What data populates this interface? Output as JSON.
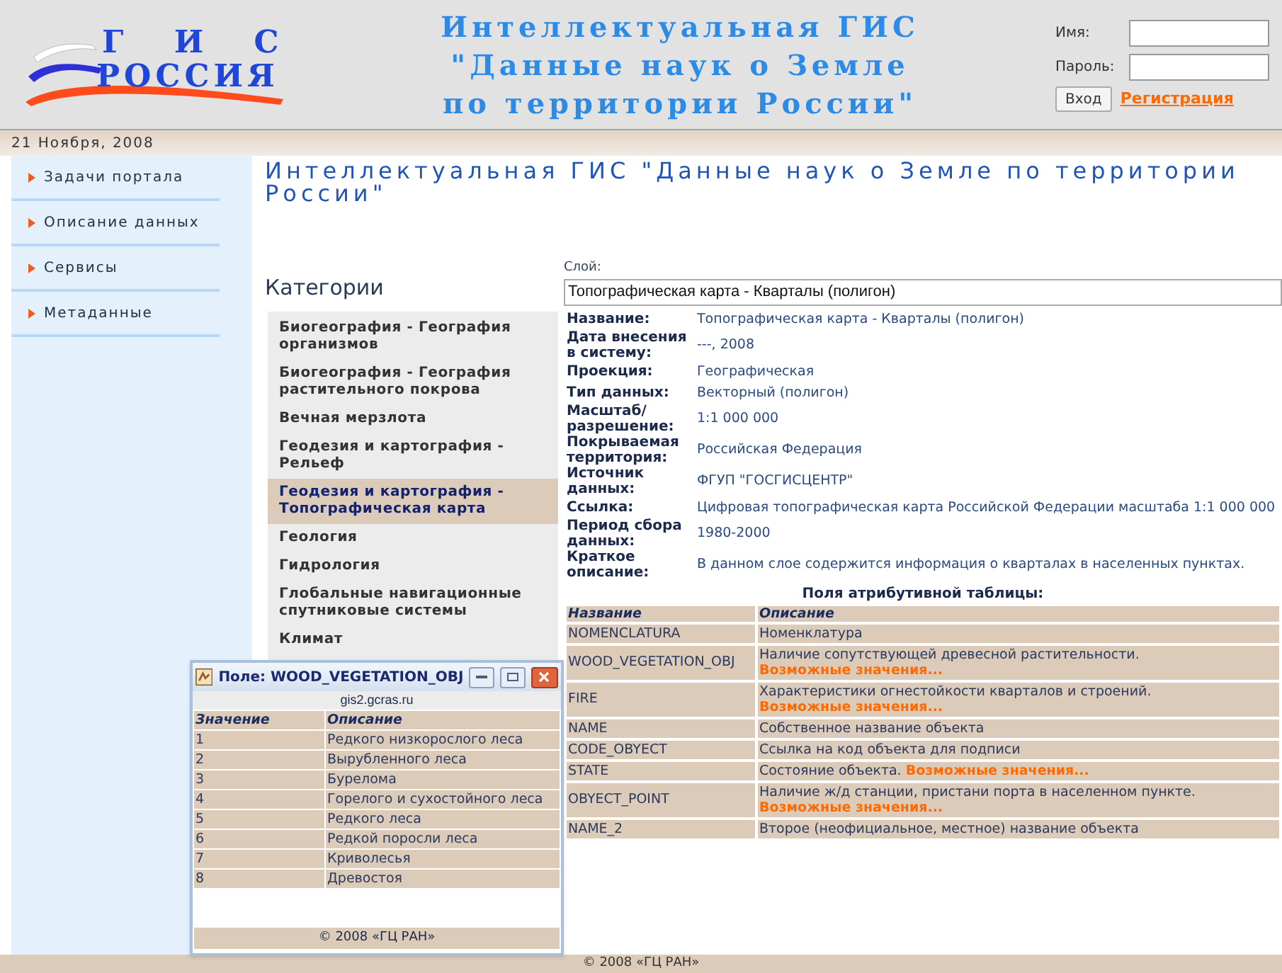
{
  "header": {
    "logo": {
      "line1": "Г И С",
      "line2": "РОССИЯ"
    },
    "title_lines": [
      "Интеллектуальная ГИС",
      "\"Данные наук о Земле",
      "по территории России\""
    ],
    "login": {
      "name_label": "Имя:",
      "password_label": "Пароль:",
      "button": "Вход",
      "register_link": "Регистрация"
    }
  },
  "date": "21 Ноября, 2008",
  "sidebar": {
    "items": [
      {
        "label": "Задачи портала"
      },
      {
        "label": "Описание данных"
      },
      {
        "label": "Сервисы"
      },
      {
        "label": "Метаданные"
      }
    ]
  },
  "page_heading": "Интеллектуальная ГИС \"Данные наук о Земле по территории России\"",
  "categories": {
    "title": "Категории",
    "items": [
      {
        "label": "Биогеография - География организмов",
        "selected": false
      },
      {
        "label": "Биогеография - География растительного покрова",
        "selected": false
      },
      {
        "label": "Вечная мерзлота",
        "selected": false
      },
      {
        "label": "Геодезия и картография - Рельеф",
        "selected": false
      },
      {
        "label": "Геодезия и картография - Топографическая карта",
        "selected": true
      },
      {
        "label": "Геология",
        "selected": false
      },
      {
        "label": "Гидрология",
        "selected": false
      },
      {
        "label": "Глобальные навигационные спутниковые системы",
        "selected": false
      },
      {
        "label": "Климат",
        "selected": false
      }
    ]
  },
  "layer": {
    "label": "Слой:",
    "value": "Топографическая карта - Кварталы (полигон)"
  },
  "properties": [
    {
      "label": "Название:",
      "value": "Топографическая карта - Кварталы (полигон)"
    },
    {
      "label": "Дата внесения в систему:",
      "value": "---, 2008"
    },
    {
      "label": "Проекция:",
      "value": "Географическая"
    },
    {
      "label": "Тип данных:",
      "value": "Векторный (полигон)"
    },
    {
      "label": "Масштаб/ разрешение:",
      "value": "1:1 000 000"
    },
    {
      "label": "Покрываемая территория:",
      "value": "Российская Федерация"
    },
    {
      "label": "Источник данных:",
      "value": "ФГУП \"ГОСГИСЦЕНТР\""
    },
    {
      "label": "Ссылка:",
      "value": "Цифровая топографическая карта Российской Федерации масштаба 1:1 000 000"
    },
    {
      "label": "Период сбора данных:",
      "value": "1980-2000"
    },
    {
      "label": "Краткое описание:",
      "value": "В данном слое содержится информация о кварталах в населенных пунктах."
    }
  ],
  "attributes": {
    "title": "Поля атрибутивной таблицы:",
    "columns": [
      "Название",
      "Описание"
    ],
    "rows": [
      {
        "name": "NOMENCLATURA",
        "description": "Номенклатура"
      },
      {
        "name": "WOOD_VEGETATION_OBJ",
        "description": "Наличие сопутствующей древесной растительности.",
        "link": "Возможные значения..."
      },
      {
        "name": "FIRE",
        "description": "Характеристики огнестойкости кварталов и строений.",
        "link": "Возможные значения..."
      },
      {
        "name": "NAME",
        "description": "Собственное название объекта"
      },
      {
        "name": "CODE_OBYECT",
        "description": "Ссылка на код объекта для подписи"
      },
      {
        "name": "STATE",
        "description": "Состояние объекта.",
        "link": "Возможные значения..."
      },
      {
        "name": "OBYECT_POINT",
        "description": "Наличие ж/д станции, пристани порта в населенном пункте.",
        "link": "Возможные значения..."
      },
      {
        "name": "NAME_2",
        "description": "Второе (неофициальное, местное) название объекта"
      }
    ]
  },
  "footer": "© 2008 «ГЦ РАН»",
  "popup": {
    "title": "Поле: WOOD_VEGETATION_OBJ",
    "address": "gis2.gcras.ru",
    "columns": [
      "Значение",
      "Описание"
    ],
    "rows": [
      {
        "value": "1",
        "description": "Редкого низкорослого леса"
      },
      {
        "value": "2",
        "description": "Вырубленного леса"
      },
      {
        "value": "3",
        "description": "Бурелома"
      },
      {
        "value": "4",
        "description": "Горелого и сухостойного леса"
      },
      {
        "value": "5",
        "description": "Редкого леса"
      },
      {
        "value": "6",
        "description": "Редкой поросли леса"
      },
      {
        "value": "7",
        "description": "Криволесья"
      },
      {
        "value": "8",
        "description": "Древостоя"
      }
    ],
    "footer": "© 2008 «ГЦ РАН»"
  }
}
